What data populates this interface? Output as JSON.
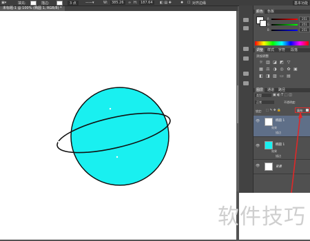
{
  "options_bar": {
    "fill_label": "填充:",
    "stroke_label": "描边:",
    "stroke_width": "3 点",
    "w_label": "W:",
    "w_value": "385.26",
    "h_label": "H:",
    "h_value": "187.64",
    "align_edges_label": "对齐边缘",
    "workspace": "基本功能"
  },
  "document_tab": {
    "label": "未标题-1 @ 100% (椭圆 1, RGB/8) *"
  },
  "color_panel": {
    "tabs": [
      "颜色",
      "色板"
    ],
    "r_label": "R",
    "r_value": "251",
    "g_label": "G",
    "g_value": "251",
    "b_label": "B",
    "b_value": "251"
  },
  "adjustments_panel": {
    "tabs": [
      "调整",
      "样式",
      "字符",
      "段落"
    ],
    "title": "添加调整"
  },
  "layers_panel": {
    "tabs": [
      "图层",
      "通道",
      "路径"
    ],
    "kind_filter": "类型",
    "blend_mode": "正常",
    "opacity_label": "不透明度:",
    "lock_label": "锁定:",
    "fill_label": "填充:",
    "layers": [
      {
        "name": "椭圆 1",
        "effects_label": "效果",
        "stroke_label": "描边",
        "thumb_color": "#ffffff"
      },
      {
        "name": "椭圆 1",
        "effects_label": "效果",
        "stroke_label": "描边",
        "thumb_color": "#19f0f0"
      },
      {
        "name": "背景",
        "thumb_color": "#ffffff"
      }
    ]
  },
  "watermark": "软件技巧",
  "colors": {
    "planet_fill": "#19f0f0",
    "highlight_box": "#e03030",
    "accent_arrow": "#e02828"
  }
}
